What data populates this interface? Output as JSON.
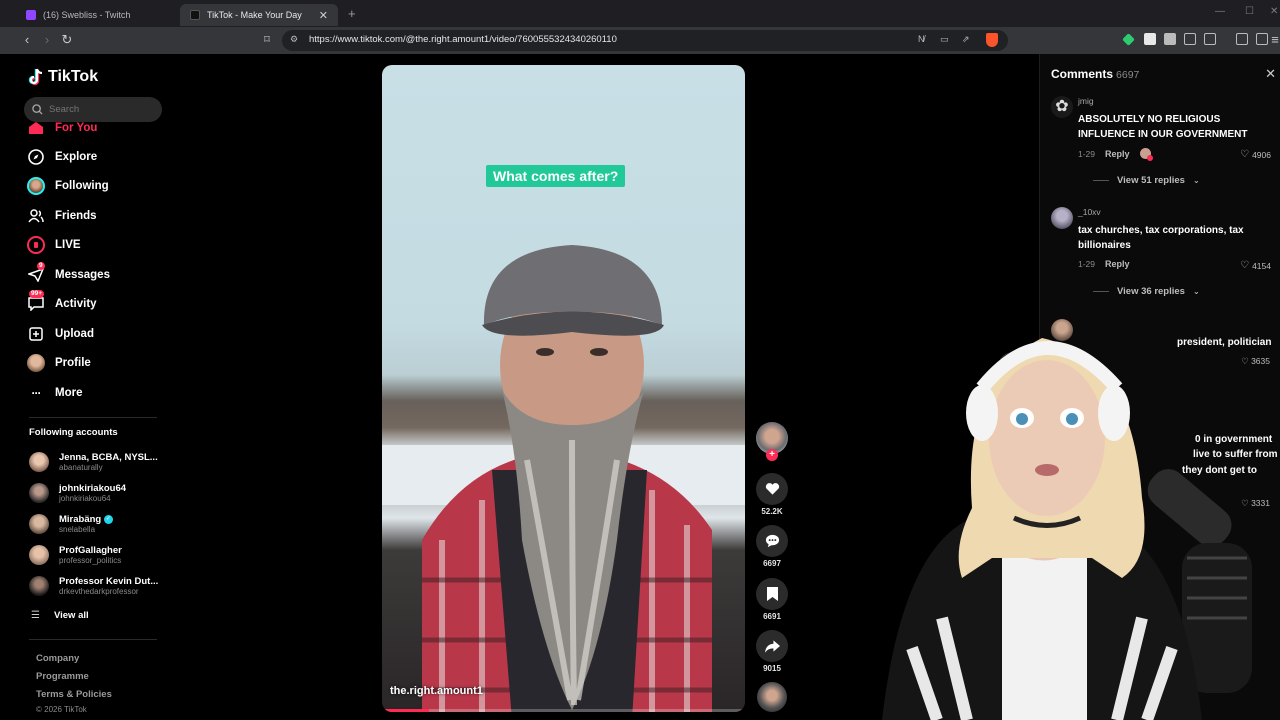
{
  "browser": {
    "tabs": [
      {
        "title": "(16) Swebliss - Twitch"
      },
      {
        "title": "TikTok - Make Your Day"
      }
    ],
    "url": "https://www.tiktok.com/@the.right.amount1/video/7600555324340260110"
  },
  "sidebar": {
    "brand": "TikTok",
    "search_placeholder": "Search",
    "nav": [
      {
        "label": "For You"
      },
      {
        "label": "Explore"
      },
      {
        "label": "Following"
      },
      {
        "label": "Friends"
      },
      {
        "label": "LIVE"
      },
      {
        "label": "Messages",
        "badge": "9"
      },
      {
        "label": "Activity",
        "badge": "99+"
      },
      {
        "label": "Upload"
      },
      {
        "label": "Profile"
      },
      {
        "label": "More"
      }
    ],
    "following_title": "Following accounts",
    "accounts": [
      {
        "name": "Jenna, BCBA, NYSL...",
        "handle": "abanaturally"
      },
      {
        "name": "johnkiriakou64",
        "handle": "johnkiriakou64"
      },
      {
        "name": "Mirabäng",
        "handle": "snelabella"
      },
      {
        "name": "ProfGallagher",
        "handle": "professor_politics"
      },
      {
        "name": "Professor Kevin Dut...",
        "handle": "drkevthedarkprofessor"
      }
    ],
    "view_all": "View all",
    "footer": [
      "Company",
      "Programme",
      "Terms & Policies"
    ],
    "copyright": "© 2026 TikTok"
  },
  "video": {
    "caption": "What comes after?",
    "username": "the.right.amount1",
    "progress": 0.13
  },
  "actions": {
    "likes": "52.2K",
    "comments": "6697",
    "saves": "6691",
    "shares": "9015"
  },
  "comments": {
    "title": "Comments",
    "count": "6697",
    "items": [
      {
        "user": "jmig",
        "text": "ABSOLUTELY NO RELIGIOUS INFLUENCE IN OUR GOVERNMENT",
        "date": "1-29",
        "reply": "Reply",
        "likes": "4906",
        "replies": "View 51 replies"
      },
      {
        "user": "_10xv",
        "text": "tax churches, tax corporations, tax billionaires",
        "date": "1-29",
        "reply": "Reply",
        "likes": "4154",
        "replies": "View 36 replies"
      }
    ],
    "partial": [
      {
        "text": "president, politician",
        "likes": "3635"
      },
      {
        "text": "0 in government",
        "likes": ""
      },
      {
        "text": "live to suffer from",
        "likes": ""
      },
      {
        "text": "they dont get to",
        "likes": ""
      },
      {
        "text": "",
        "likes": "3331"
      }
    ]
  },
  "colors": {
    "accent": "#fe2c55",
    "caption_bg": "#20c997",
    "panel_bg": "#0a0a0a"
  }
}
